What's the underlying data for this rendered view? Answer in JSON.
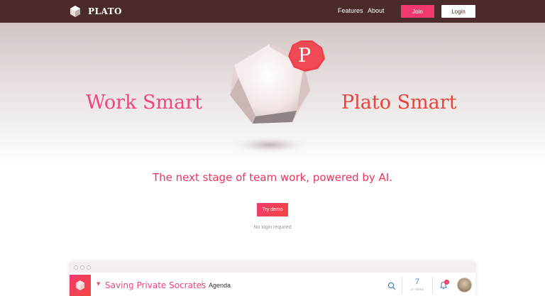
{
  "nav": {
    "brand": "PLATO",
    "features_label": "Features",
    "about_label": "About",
    "join_label": "Join",
    "login_label": "Login"
  },
  "hero": {
    "logo_letter": "P",
    "left_text": "Work Smart",
    "right_text": "Plato Smart",
    "tagline": "The next stage of team work, powered by AI.",
    "demo_button": "Try demo",
    "demo_note": "No login required"
  },
  "preview": {
    "project_title": "Saving Private Socrates",
    "breadcrumb_separator": "/",
    "breadcrumb_item": "Agenda",
    "task_count": "7",
    "task_label": "47 TASKS",
    "notification_badge": "3"
  },
  "colors": {
    "nav_bg": "#4a2a2a",
    "accent_pink": "#f2396f",
    "accent_red": "#e8433d"
  }
}
